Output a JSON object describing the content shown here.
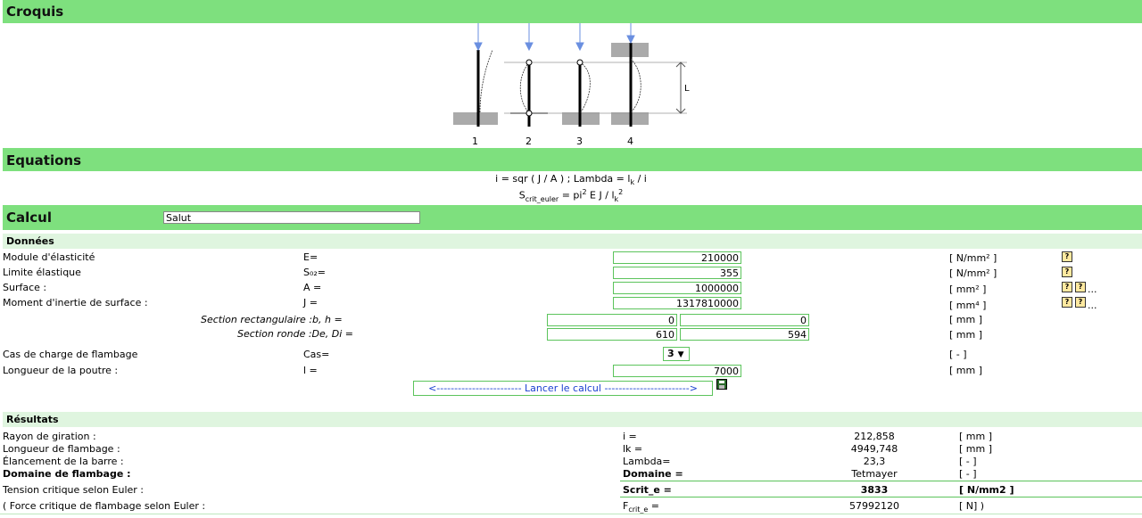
{
  "croquis": {
    "title": "Croquis",
    "labels": [
      "1",
      "2",
      "3",
      "4"
    ],
    "l_label": "L"
  },
  "equations": {
    "title": "Equations",
    "line1_a": "i = sqr ( J / A ) ; Lambda = l",
    "line1_sub": "k",
    "line1_b": " / i",
    "line2_a": "S",
    "line2_sub": "crit_euler",
    "line2_b": " = pi",
    "line2_sup": "2",
    "line2_c": " E J / l",
    "line2_sub2": "k",
    "line2_sup2": "2"
  },
  "calcul": {
    "title": "Calcul",
    "name_value": "Salut"
  },
  "donnees": {
    "title": "Données",
    "rows": [
      {
        "label": "Module d'élasticité",
        "sym": "E=",
        "value": "210000",
        "unit": "[ N/mm² ]"
      },
      {
        "label": "Limite élastique",
        "sym": "S₀₂=",
        "value": "355",
        "unit": "[ N/mm² ]"
      },
      {
        "label": "Surface :",
        "sym": "A =",
        "value": "1000000",
        "unit": "[ mm² ]"
      },
      {
        "label": "Moment d'inertie de surface :",
        "sym": "J =",
        "value": "1317810000",
        "unit": "[ mm⁴ ]"
      }
    ],
    "rect": {
      "label": "Section rectangulaire :b, h =",
      "b": "0",
      "h": "0",
      "unit": "[ mm ]"
    },
    "ronde": {
      "label": "Section ronde :De, Di =",
      "de": "610",
      "di": "594",
      "unit": "[ mm ]"
    },
    "cas": {
      "label": "Cas de charge de flambage",
      "sym": "Cas=",
      "value": "3",
      "unit": "[ - ]"
    },
    "longueur": {
      "label": "Longueur de la poutre :",
      "sym": "l =",
      "value": "7000",
      "unit": "[ mm ]"
    },
    "button": "<------------------------  Lancer le calcul  ------------------------>",
    "ellipsis": "..."
  },
  "resultats": {
    "title": "Résultats",
    "rows": [
      {
        "label": "Rayon de giration :",
        "sym": "i =",
        "value": "212,858",
        "unit": "[ mm ]"
      },
      {
        "label": "Longueur de flambage :",
        "sym": "lk =",
        "value": "4949,748",
        "unit": "[ mm ]"
      },
      {
        "label": "Élancement de la barre :",
        "sym": "Lambda=",
        "value": "23,3",
        "unit": "[ - ]"
      },
      {
        "label": "Domaine de flambage :",
        "sym": "Domaine =",
        "value": "Tetmayer",
        "unit": "[ - ]"
      },
      {
        "label": "Tension critique selon Euler :",
        "sym": "Scrit_e =",
        "value": "3833",
        "unit": "[ N/mm2 ]"
      },
      {
        "label": "( Force critique de flambage selon Euler :",
        "sym": "F",
        "sym_sub": "crit_e",
        "sym_b": " =",
        "value": "57992120",
        "unit": "[ N] )"
      }
    ]
  }
}
